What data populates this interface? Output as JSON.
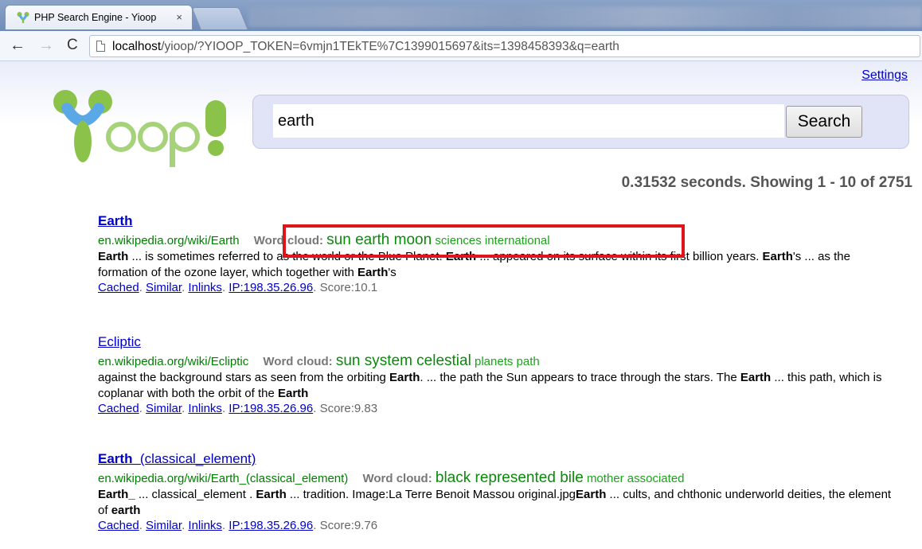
{
  "browser": {
    "tab_title": "PHP Search Engine - Yioop",
    "tab_close": "×",
    "url_host": "localhost",
    "url_rest": "/yioop/?YIOOP_TOKEN=6vmjn1TEkTE%7C1399015697&its=1398458393&q=earth",
    "nav": {
      "back": "←",
      "forward": "→",
      "reload": "C"
    }
  },
  "header": {
    "settings_label": "Settings",
    "logo_alt": "Yioop!",
    "search_value": "earth",
    "search_button": "Search"
  },
  "stats": "0.31532 seconds. Showing 1 - 10 of 2751",
  "results": [
    {
      "title_a": "Earth",
      "title_b": "",
      "url": "en.wikipedia.org/wiki/Earth",
      "wordcloud_label": "Word cloud:",
      "wordcloud_big": "sun earth moon",
      "wordcloud_small": "sciences international",
      "snippet_html": "<b>Earth</b> ... is sometimes referred to as the world or the Blue Planet. <b>Earth</b> ... appeared on its surface within its first billion years. <b>Earth</b>'s ... as the formation of the ozone layer, which together with <b>Earth</b>'s",
      "link_cached": "Cached",
      "link_similar": "Similar",
      "link_inlinks": "Inlinks",
      "link_ip": "IP:198.35.26.96",
      "score": "Score:10.1"
    },
    {
      "title_a": "Ecliptic",
      "title_b": "",
      "url": "en.wikipedia.org/wiki/Ecliptic",
      "wordcloud_label": "Word cloud:",
      "wordcloud_big": "sun system celestial",
      "wordcloud_small": "planets path",
      "snippet_html": "against the background stars as seen from the orbiting <b>Earth</b>. ... the path the Sun appears to trace through the stars. The <b>Earth</b> ... this path, which is coplanar with both the orbit of the <b>Earth</b>",
      "link_cached": "Cached",
      "link_similar": "Similar",
      "link_inlinks": "Inlinks",
      "link_ip": "IP:198.35.26.96",
      "score": "Score:9.83"
    },
    {
      "title_a": "Earth_",
      "title_b": "(classical_element)",
      "url": "en.wikipedia.org/wiki/Earth_(classical_element)",
      "wordcloud_label": "Word cloud:",
      "wordcloud_big": "black represented bile",
      "wordcloud_small": "mother associated",
      "snippet_html": "<b>Earth_</b> ... classical_element . <b>Earth</b> ... tradition. Image:La Terre Benoit Massou original.jpg<b>Earth</b> ... cults, and chthonic underworld deities, the element of <b>earth</b>",
      "link_cached": "Cached",
      "link_similar": "Similar",
      "link_inlinks": "Inlinks",
      "link_ip": "IP:198.35.26.96",
      "score": "Score:9.76"
    }
  ],
  "colors": {
    "link": "#0000cc",
    "url_green": "#008000",
    "wordcloud_green": "#0a8a0a",
    "highlight_red": "#e0141b",
    "logo_green": "#8bc34a",
    "logo_blue": "#5aa9e6"
  }
}
